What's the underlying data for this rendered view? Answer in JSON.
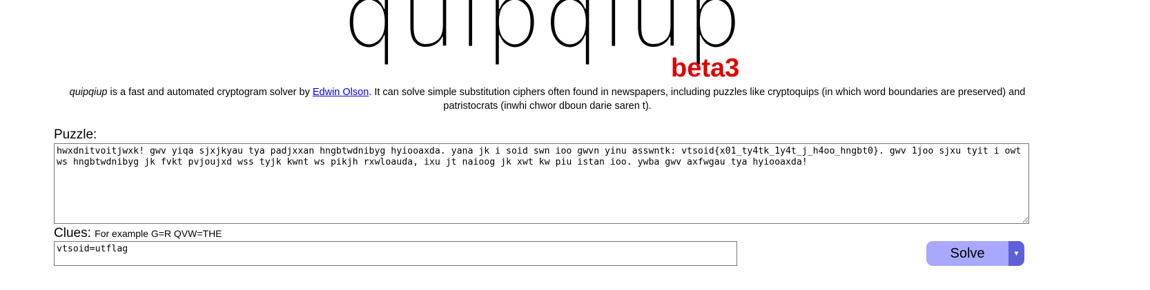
{
  "logo": {
    "title": "quipqiup",
    "badge": "beta3"
  },
  "intro": {
    "app_name": "quipqiup",
    "text_before_link": " is a fast and automated cryptogram solver by ",
    "author_link": "Edwin Olson",
    "text_after_link": ". It can solve simple substitution ciphers often found in newspapers, including puzzles like cryptoquips (in which word boundaries are preserved) and patristocrats (inwhi chwor dboun darie saren t)."
  },
  "puzzle": {
    "label": "Puzzle:",
    "value": "hwxdnitvoitjwxk! gwv yiqa sjxjkyau tya padjxxan hngbtwdnibyg hyiooaxda. yana jk i soid swn ioo gwvn yinu asswntk: vtsoid{x01_ty4tk_1y4t_j_h4oo_hngbt0}. gwv 1joo sjxu tyit i owt ws hngbtwdnibyg jk fvkt pvjoujxd wss tyjk kwnt ws pikjh rxwloauda, ixu jt naioog jk xwt kw piu istan ioo. ywba gwv axfwgau tya hyiooaxda!"
  },
  "clues": {
    "label": "Clues:",
    "hint": "For example G=R QVW=THE",
    "value": "vtsoid=utflag"
  },
  "actions": {
    "solve_label": "Solve",
    "menu_icon": "caret-down-icon"
  },
  "colors": {
    "badge": "#e00000",
    "link": "#0000ee",
    "solve_bg": "#a8a8ff",
    "solve_menu_bg": "#5f5fd8"
  }
}
